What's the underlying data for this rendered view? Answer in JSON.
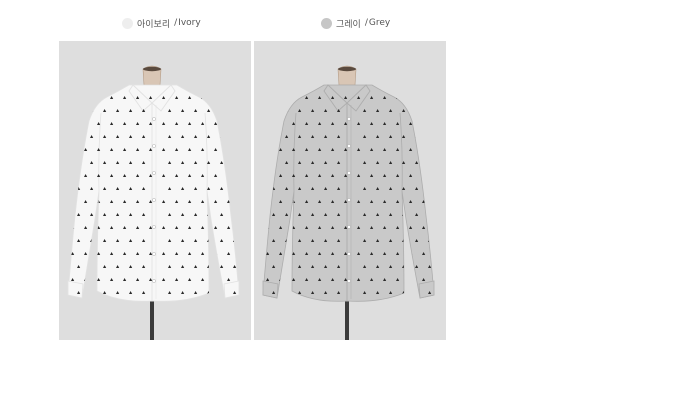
{
  "products": [
    {
      "color_name_ko": "아이보리",
      "color_name_en": "Ivory",
      "separator": "/",
      "swatch_color": "#eeeeee",
      "photo_bg": "#dedede",
      "shirt_color": "#f7f7f7",
      "shirt_shade": "#e2e2e2",
      "dot_color": "#2a2a2a"
    },
    {
      "color_name_ko": "그레이",
      "color_name_en": "Grey",
      "separator": "/",
      "swatch_color": "#c6c6c6",
      "photo_bg": "#dedede",
      "shirt_color": "#c9c9c9",
      "shirt_shade": "#adadad",
      "dot_color": "#2a2a2a"
    }
  ]
}
